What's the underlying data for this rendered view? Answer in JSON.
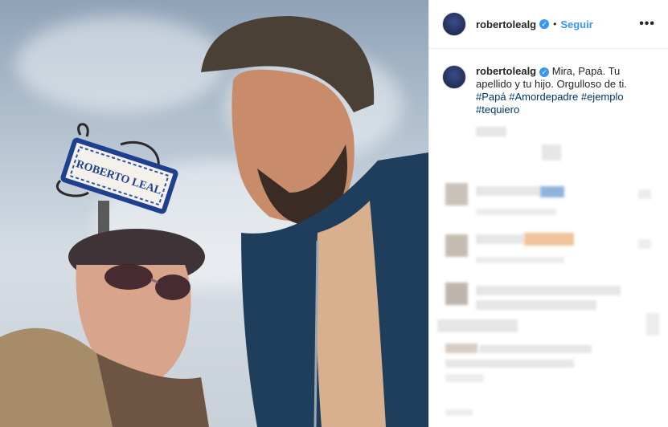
{
  "post": {
    "author": "robertolealg",
    "follow_label": "Seguir",
    "more_label": "•••",
    "verified_glyph": "✓"
  },
  "caption": {
    "username": "robertolealg",
    "text": "Mira, Papá. Tu apellido y tu hijo. Orgulloso de ti.",
    "hashtags": [
      "#Papá",
      "#Amordepadre",
      "#ejemplo",
      "#tequiero"
    ]
  },
  "photo": {
    "sign_text": "ROBERTO LEAL"
  },
  "colors": {
    "link": "#3897f0",
    "hashtag": "#003569",
    "verified": "#3897f0"
  }
}
